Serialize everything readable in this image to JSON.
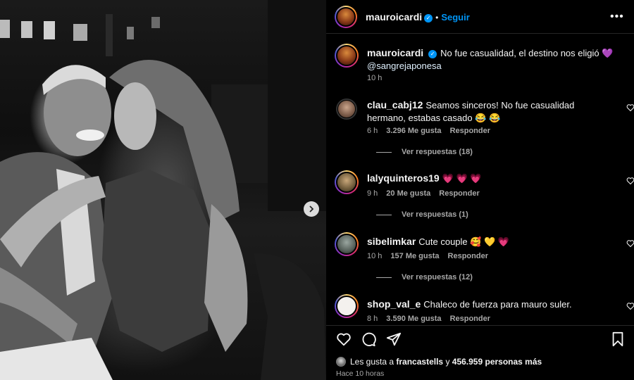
{
  "post": {
    "author": "mauroicardi",
    "follow_label": "Seguir",
    "caption_text": "No fue casualidad, el destino nos eligió 💜",
    "caption_mention": "@sangrejaponesa",
    "caption_time": "10 h"
  },
  "comments": [
    {
      "username": "clau_cabj12",
      "text": "Seamos sinceros! No fue casualidad hermano, estabas casado 😂 😂",
      "time": "6 h",
      "likes": "3.296 Me gusta",
      "reply": "Responder",
      "replies": "Ver respuestas (18)"
    },
    {
      "username": "lalyquinteros19",
      "text": "💗 💗 💗",
      "time": "9 h",
      "likes": "20 Me gusta",
      "reply": "Responder",
      "replies": "Ver respuestas (1)"
    },
    {
      "username": "sibelimkar",
      "text": "Cute couple 🥰 💛 💗",
      "time": "10 h",
      "likes": "157 Me gusta",
      "reply": "Responder",
      "replies": "Ver respuestas (12)"
    },
    {
      "username": "shop_val_e",
      "text": "Chaleco de fuerza para mauro suler.",
      "time": "8 h",
      "likes": "3.590 Me gusta",
      "reply": "Responder"
    }
  ],
  "footer": {
    "likes_prefix": "Les gusta a",
    "likes_user": "francastells",
    "likes_middle": "y",
    "likes_count": "456.959 personas más",
    "timestamp": "Hace 10 horas"
  },
  "icons": [
    "more-icon",
    "heart-icon",
    "comment-icon",
    "share-icon",
    "bookmark-icon",
    "carousel-next-icon",
    "verified-icon"
  ]
}
